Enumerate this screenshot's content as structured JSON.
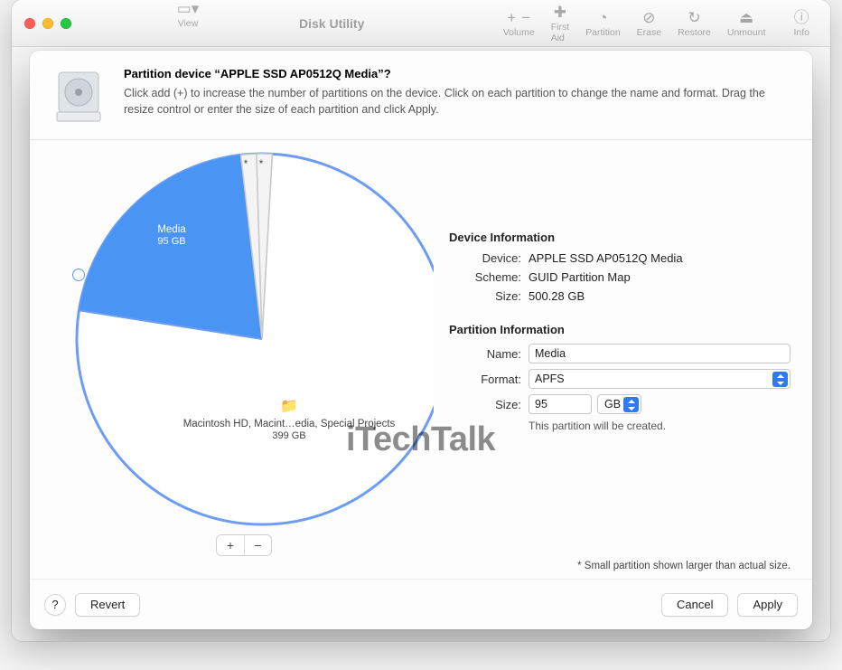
{
  "toolbar": {
    "title": "Disk Utility",
    "view": "View",
    "volume": "Volume",
    "first_aid": "First Aid",
    "partition": "Partition",
    "erase": "Erase",
    "restore": "Restore",
    "unmount": "Unmount",
    "info": "Info"
  },
  "sheet": {
    "title": "Partition device “APPLE SSD AP0512Q Media”?",
    "subtitle": "Click add (+) to increase the number of partitions on the device. Click on each partition to change the name and format. Drag the resize control or enter the size of each partition and click Apply."
  },
  "chart_data": {
    "type": "pie",
    "title": "",
    "series": [
      {
        "name": "Media",
        "value_gb": 95,
        "label": "Media",
        "sublabel": "95 GB",
        "selected": true
      },
      {
        "name": "small-1",
        "value_gb": 0.5,
        "label": "*",
        "selected": false
      },
      {
        "name": "small-2",
        "value_gb": 0.5,
        "label": "*",
        "selected": false
      },
      {
        "name": "Macintosh HD",
        "value_gb": 399,
        "label": "Macintosh HD, Macint…edia, Special Projects",
        "sublabel": "399 GB",
        "selected": false
      }
    ],
    "total_gb": 500.28
  },
  "pie_labels": {
    "media_name": "Media",
    "media_size": "95 GB",
    "main_name": "Macintosh HD, Macint…edia, Special Projects",
    "main_size": "399 GB",
    "star": "*"
  },
  "device_info": {
    "heading": "Device Information",
    "device_k": "Device:",
    "device_v": "APPLE SSD AP0512Q Media",
    "scheme_k": "Scheme:",
    "scheme_v": "GUID Partition Map",
    "size_k": "Size:",
    "size_v": "500.28 GB"
  },
  "partition_info": {
    "heading": "Partition Information",
    "name_k": "Name:",
    "name_v": "Media",
    "format_k": "Format:",
    "format_v": "APFS",
    "size_k": "Size:",
    "size_v": "95",
    "size_unit": "GB",
    "note": "This partition will be created."
  },
  "footer_note": "* Small partition shown larger than actual size.",
  "buttons": {
    "help": "?",
    "revert": "Revert",
    "cancel": "Cancel",
    "apply": "Apply",
    "add": "+",
    "remove": "−"
  },
  "watermark": "iTechTalk"
}
